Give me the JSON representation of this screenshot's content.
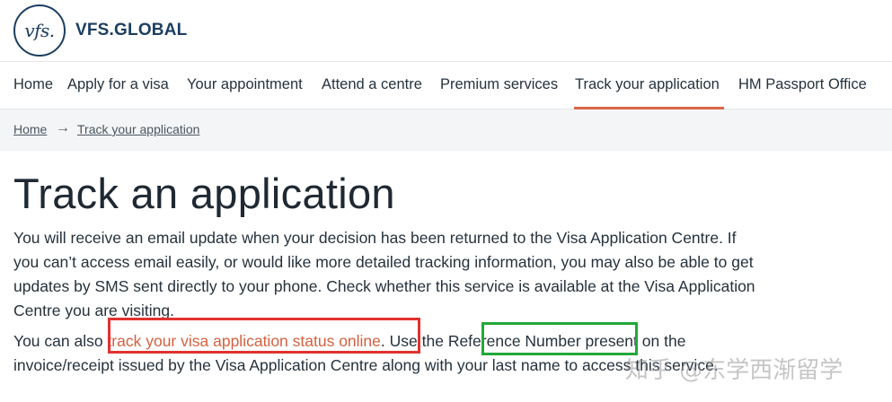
{
  "header": {
    "logo_mark": "vfs.",
    "logo_text": "VFS.GLOBAL"
  },
  "nav": {
    "items": [
      {
        "label": "Home"
      },
      {
        "label": "Apply for a visa"
      },
      {
        "label": "Your appointment"
      },
      {
        "label": "Attend a centre"
      },
      {
        "label": "Premium services"
      },
      {
        "label": "Track your application",
        "active": true
      },
      {
        "label": "HM Passport Office"
      }
    ],
    "active_color": "#d9684b"
  },
  "breadcrumb": {
    "home": "Home",
    "current": "Track your application"
  },
  "main": {
    "title": "Track an application",
    "para1": [
      "You will receive an email update when your decision has been returned to the Visa Application Centre. If",
      "you can’t access email easily, or would like more detailed tracking information, you may also be able to get",
      "updates by SMS sent directly to your phone. Check whether this service is available at the Visa Application",
      "Centre you are visiting."
    ],
    "para2_before": "You can also ",
    "para2_link": "track your visa application status online",
    "para2_mid": ". Use the ",
    "para2_ref": "Reference Number",
    "para2_after": " present on the",
    "para2_line2": "invoice/receipt issued by the Visa Application Centre along with your last name to access this service."
  },
  "annotations": {
    "red_box_color": "#e0322f",
    "green_box_color": "#22a83a"
  },
  "watermark": "知乎 @东学西渐留学",
  "icons": {
    "breadcrumb_separator": "arrow-right-icon"
  }
}
